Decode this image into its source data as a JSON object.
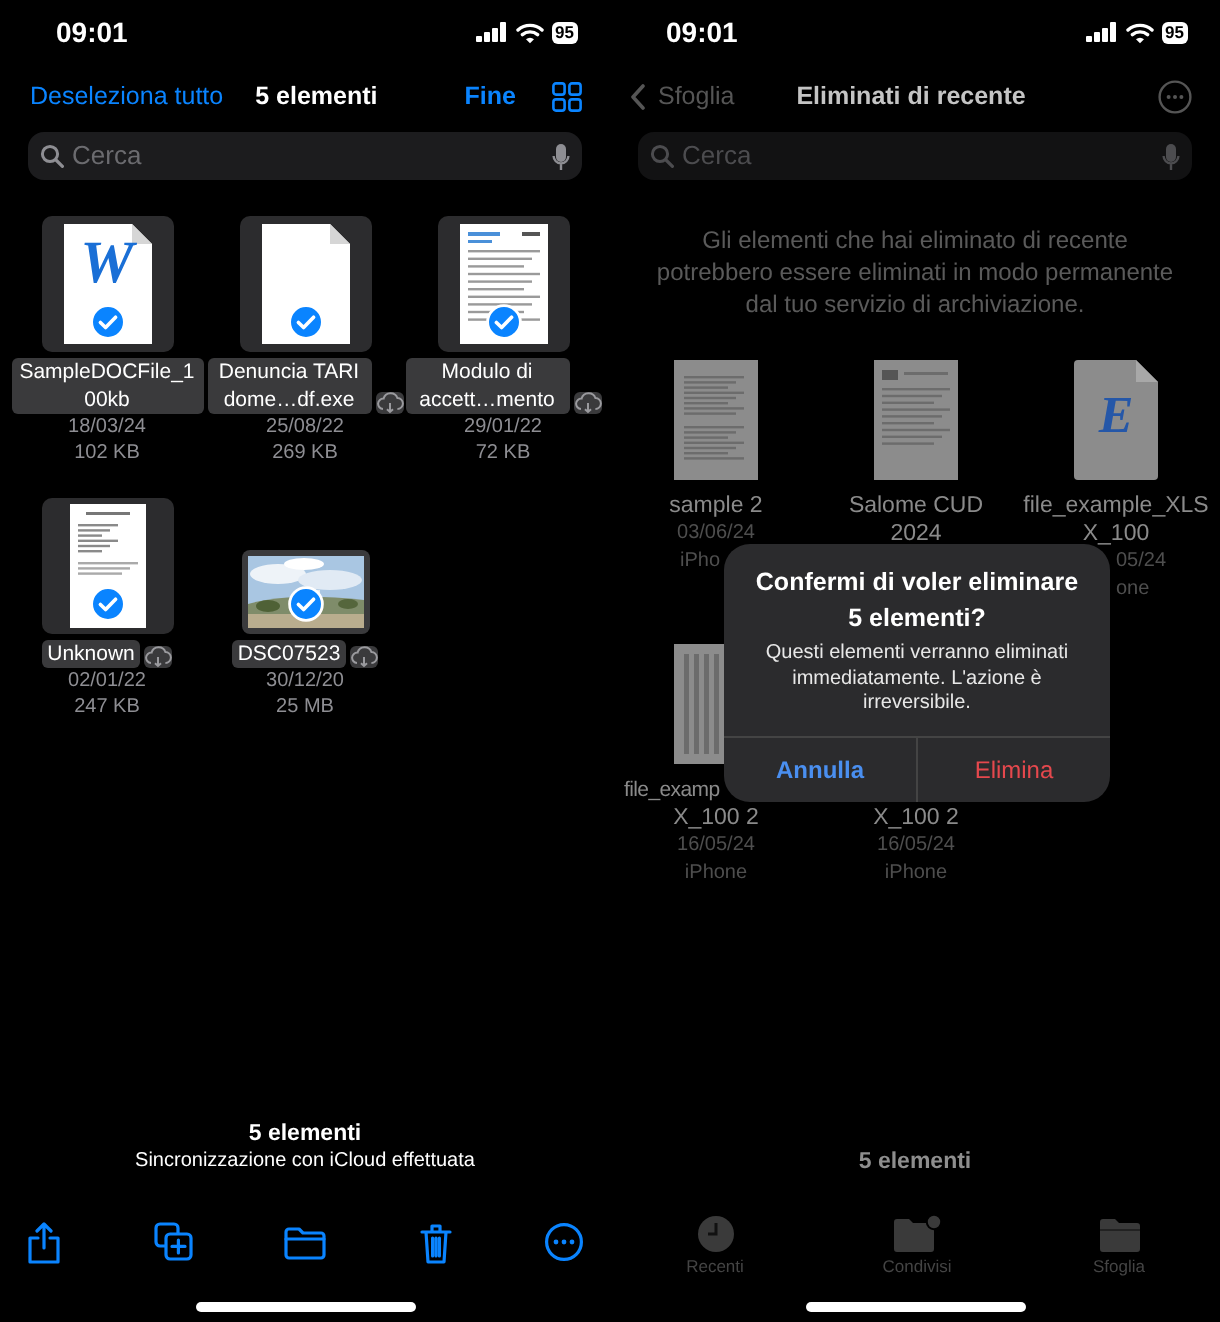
{
  "selection_screen": {
    "status_bar": {
      "time": "09:01",
      "battery": "95"
    },
    "nav": {
      "deselect": "Deseleziona tutto",
      "title": "5 elementi",
      "done": "Fine"
    },
    "search": {
      "placeholder": "Cerca"
    },
    "files": [
      {
        "name": "SampleDOCFile_100kb",
        "date": "18/03/24",
        "size": "102 KB",
        "kind": "word",
        "glyph": "W",
        "selected": true,
        "in_cloud": false
      },
      {
        "name": "Denuncia TARI dome…df.exe",
        "date": "25/08/22",
        "size": "269 KB",
        "kind": "blank",
        "selected": true,
        "in_cloud": true
      },
      {
        "name": "Modulo di accett…mento",
        "date": "29/01/22",
        "size": "72 KB",
        "kind": "document",
        "selected": true,
        "in_cloud": true
      },
      {
        "name": "Unknown",
        "date": "02/01/22",
        "size": "247 KB",
        "kind": "letter",
        "selected": true,
        "in_cloud": true
      },
      {
        "name": "DSC07523",
        "date": "30/12/20",
        "size": "25 MB",
        "kind": "picture",
        "selected": true,
        "in_cloud": true
      }
    ],
    "footer": {
      "count": "5 elementi",
      "sync": "Sincronizzazione con iCloud effettuata"
    }
  },
  "recently_deleted_screen": {
    "status_bar": {
      "time": "09:01",
      "battery": "95"
    },
    "nav": {
      "back": "Sfoglia",
      "title": "Eliminati di recente"
    },
    "search": {
      "placeholder": "Cerca"
    },
    "notice": "Gli elementi che hai eliminato di recente potrebbero essere eliminati in modo permanente dal tuo servizio di archiviazione.",
    "files": [
      {
        "name_lines": [
          "sample 2"
        ],
        "date": "03/06/24",
        "device": "iPho",
        "kind": "document"
      },
      {
        "name_lines": [
          "Salome CUD",
          "2024"
        ],
        "kind": "form"
      },
      {
        "name_lines": [
          "file_example_XLS",
          "X_100"
        ],
        "date": "05/24",
        "device": "one",
        "kind": "spreadsheet",
        "glyph": "E"
      },
      {
        "name_lines": [
          "file_examp",
          "X_100 2"
        ],
        "date": "16/05/24",
        "device": "iPhone",
        "kind": "table"
      },
      {
        "name_lines": [
          "X_100 2"
        ],
        "date": "16/05/24",
        "device": "iPhone"
      }
    ],
    "dialog": {
      "title": "Confermi di voler eliminare 5 elementi?",
      "message": "Questi elementi verranno eliminati immediatamente. L'azione è irreversibile.",
      "buttons": [
        {
          "label": "Annulla",
          "kind": "cancel"
        },
        {
          "label": "Elimina",
          "kind": "destructive"
        }
      ]
    },
    "footer": {
      "count": "5 elementi"
    },
    "tab_bar": [
      {
        "label": "Recenti",
        "kind": "recents"
      },
      {
        "label": "Condivisi",
        "kind": "shared"
      },
      {
        "label": "Sfoglia",
        "kind": "browse"
      }
    ]
  }
}
